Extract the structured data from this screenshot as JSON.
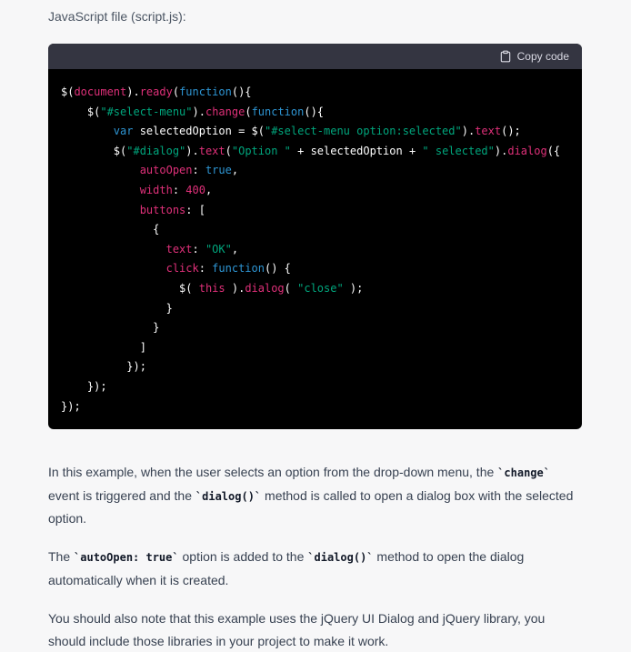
{
  "caption": "JavaScript file (script.js):",
  "code_header": {
    "copy_label": "Copy code",
    "copy_icon": "clipboard-icon"
  },
  "code": [
    [
      [
        "$(",
        "n"
      ],
      [
        "document",
        "p"
      ],
      [
        ").",
        "n"
      ],
      [
        "ready",
        "p"
      ],
      [
        "(",
        "n"
      ],
      [
        "function",
        "k"
      ],
      [
        "(){",
        "n"
      ]
    ],
    [
      [
        "    $(",
        "n"
      ],
      [
        "\"#select-menu\"",
        "s"
      ],
      [
        ").",
        "n"
      ],
      [
        "change",
        "p"
      ],
      [
        "(",
        "n"
      ],
      [
        "function",
        "k"
      ],
      [
        "(){",
        "n"
      ]
    ],
    [
      [
        "        ",
        "n"
      ],
      [
        "var",
        "k"
      ],
      [
        " selectedOption = $(",
        "n"
      ],
      [
        "\"#select-menu option:selected\"",
        "s"
      ],
      [
        ").",
        "n"
      ],
      [
        "text",
        "p"
      ],
      [
        "();",
        "n"
      ]
    ],
    [
      [
        "        $(",
        "n"
      ],
      [
        "\"#dialog\"",
        "s"
      ],
      [
        ").",
        "n"
      ],
      [
        "text",
        "p"
      ],
      [
        "(",
        "n"
      ],
      [
        "\"Option \"",
        "s"
      ],
      [
        " + selectedOption + ",
        "n"
      ],
      [
        "\" selected\"",
        "s"
      ],
      [
        ").",
        "n"
      ],
      [
        "dialog",
        "p"
      ],
      [
        "({",
        "n"
      ]
    ],
    [
      [
        "            ",
        "n"
      ],
      [
        "autoOpen",
        "p"
      ],
      [
        ": ",
        "n"
      ],
      [
        "true",
        "k"
      ],
      [
        ",",
        "n"
      ]
    ],
    [
      [
        "            ",
        "n"
      ],
      [
        "width",
        "p"
      ],
      [
        ": ",
        "n"
      ],
      [
        "400",
        "p"
      ],
      [
        ",",
        "n"
      ]
    ],
    [
      [
        "            ",
        "n"
      ],
      [
        "buttons",
        "p"
      ],
      [
        ": [",
        "n"
      ]
    ],
    [
      [
        "              {",
        "n"
      ]
    ],
    [
      [
        "                ",
        "n"
      ],
      [
        "text",
        "p"
      ],
      [
        ": ",
        "n"
      ],
      [
        "\"OK\"",
        "s"
      ],
      [
        ",",
        "n"
      ]
    ],
    [
      [
        "                ",
        "n"
      ],
      [
        "click",
        "p"
      ],
      [
        ": ",
        "n"
      ],
      [
        "function",
        "k"
      ],
      [
        "() {",
        "n"
      ]
    ],
    [
      [
        "                  $( ",
        "n"
      ],
      [
        "this",
        "p"
      ],
      [
        " ).",
        "n"
      ],
      [
        "dialog",
        "p"
      ],
      [
        "( ",
        "n"
      ],
      [
        "\"close\"",
        "s"
      ],
      [
        " );",
        "n"
      ]
    ],
    [
      [
        "                }",
        "n"
      ]
    ],
    [
      [
        "              }",
        "n"
      ]
    ],
    [
      [
        "            ]",
        "n"
      ]
    ],
    [
      [
        "          });",
        "n"
      ]
    ],
    [
      [
        "    });",
        "n"
      ]
    ],
    [
      [
        "});",
        "n"
      ]
    ]
  ],
  "paragraphs": [
    [
      [
        "In this example, when the user selects an option from the drop-down menu, the ",
        "text"
      ],
      [
        "`change`",
        "code"
      ],
      [
        " event is triggered and the ",
        "text"
      ],
      [
        "`dialog()`",
        "code"
      ],
      [
        " method is called to open a dialog box with the selected option.",
        "text"
      ]
    ],
    [
      [
        "The ",
        "text"
      ],
      [
        "`autoOpen: true`",
        "code"
      ],
      [
        " option is added to the ",
        "text"
      ],
      [
        "`dialog()`",
        "code"
      ],
      [
        " method to open the dialog automatically when it is created.",
        "text"
      ]
    ],
    [
      [
        "You should also note that this example uses the jQuery UI Dialog and jQuery library, you should include those libraries in your project to make it work.",
        "text"
      ]
    ]
  ]
}
